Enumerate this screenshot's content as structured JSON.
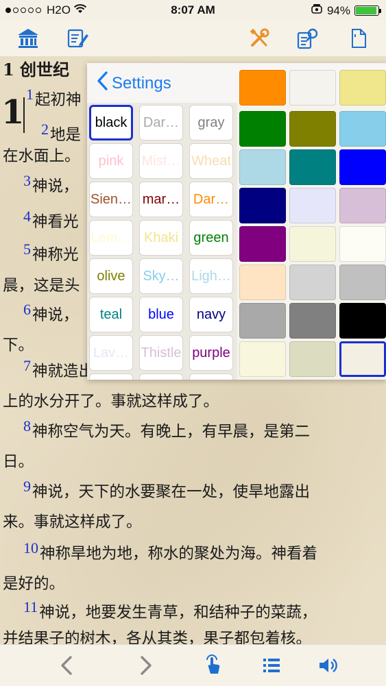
{
  "status_bar": {
    "carrier": "H2O",
    "signal_bars_filled": 1,
    "signal_bars_total": 5,
    "time": "8:07 AM",
    "battery_text": "94%",
    "battery_level": 0.94,
    "icons": [
      "wifi-icon",
      "alarm-icon",
      "battery-icon"
    ]
  },
  "toolbar": {
    "icons": [
      "library-icon",
      "notes-icon",
      "tools-icon",
      "search-icon",
      "document-icon"
    ]
  },
  "reader": {
    "book_title": "1 创世纪",
    "chapter_number": "1",
    "lines": [
      {
        "num": "1",
        "text": "起初神"
      },
      {
        "num": "2",
        "text": "地是"
      },
      {
        "num": "",
        "text": "在水面上。"
      },
      {
        "num": "3",
        "text": "神说，"
      },
      {
        "num": "4",
        "text": "神看光"
      },
      {
        "num": "5",
        "text": "神称光"
      },
      {
        "num": "",
        "text": "晨，这是头"
      },
      {
        "num": "6",
        "text": "神说，"
      },
      {
        "num": "",
        "text": "下。"
      },
      {
        "num": "7",
        "text": "神就造出空气，将空气以下的水，空气以"
      },
      {
        "num": "",
        "text": "上的水分开了。事就这样成了。"
      },
      {
        "num": "8",
        "text": "神称空气为天。有晚上，有早晨，是第二"
      },
      {
        "num": "",
        "text": "日。"
      },
      {
        "num": "9",
        "text": "神说，天下的水要聚在一处，使旱地露出"
      },
      {
        "num": "",
        "text": "来。事就这样成了。"
      },
      {
        "num": "10",
        "text": "神称旱地为地，称水的聚处为海。神看着"
      },
      {
        "num": "",
        "text": "是好的。"
      },
      {
        "num": "11",
        "text": "神说，地要发生青草，和结种子的菜蔬，"
      },
      {
        "num": "",
        "text": "并结果子的树木，各从其类，果子都包着核。"
      }
    ]
  },
  "popover": {
    "back_label": "Settings",
    "color_names": [
      {
        "label": "black",
        "color": "#000000",
        "selected": true
      },
      {
        "label": "Dar…",
        "color": "#a9a9a9"
      },
      {
        "label": "gray",
        "color": "#808080"
      },
      {
        "label": "pink",
        "color": "#ffc0cb"
      },
      {
        "label": "Mist…",
        "color": "#ffe4e1"
      },
      {
        "label": "Wheat",
        "color": "#f5deb3"
      },
      {
        "label": "Sien…",
        "color": "#a0522d"
      },
      {
        "label": "mar…",
        "color": "#800000"
      },
      {
        "label": "Dar…",
        "color": "#ff8c00"
      },
      {
        "label": "Lem…",
        "color": "#fffacd"
      },
      {
        "label": "Khaki",
        "color": "#f0e68c"
      },
      {
        "label": "green",
        "color": "#008000"
      },
      {
        "label": "olive",
        "color": "#808000"
      },
      {
        "label": "Sky…",
        "color": "#87ceeb"
      },
      {
        "label": "Ligh…",
        "color": "#add8e6"
      },
      {
        "label": "teal",
        "color": "#008080"
      },
      {
        "label": "blue",
        "color": "#0000ff"
      },
      {
        "label": "navy",
        "color": "#000080"
      },
      {
        "label": "Lav…",
        "color": "#e6e6fa"
      },
      {
        "label": "Thistle",
        "color": "#d8bfd8"
      },
      {
        "label": "purple",
        "color": "#800080"
      }
    ],
    "swatches": [
      "#008000",
      "#808000",
      "#87ceeb",
      "#add8e6",
      "#008080",
      "#0000ff",
      "#000080",
      "#e6e6fa",
      "#d8bfd8",
      "#800080",
      "#f5f5dc",
      "#fdfdf5",
      "#ffe4c4",
      "#d3d3d3",
      "#c0c0c0",
      "#a9a9a9",
      "#808080",
      "#000000",
      "#f8f6dc",
      "#dcdcc0",
      "#f3efe2"
    ],
    "swatch_selected_index": 20,
    "swatch_top_partial": [
      "#ff8c00",
      "#f5f3ed",
      "#f0e68c"
    ]
  },
  "bottom_bar": {
    "icons": [
      "back-chevron-icon",
      "forward-chevron-icon",
      "touch-icon",
      "list-icon",
      "speaker-icon"
    ]
  }
}
